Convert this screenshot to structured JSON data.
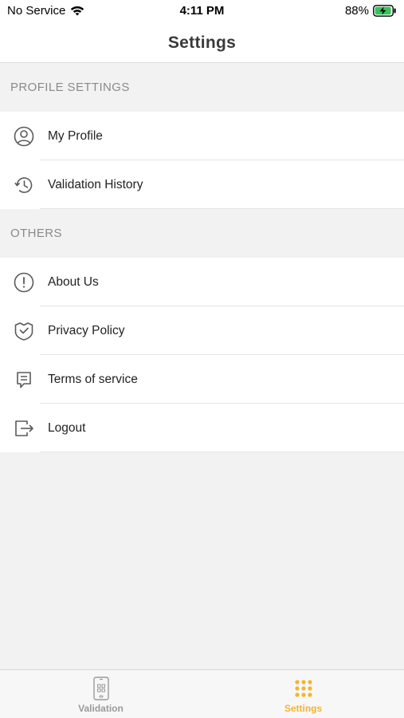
{
  "status_bar": {
    "carrier": "No Service",
    "time": "4:11 PM",
    "battery": "88%"
  },
  "header": {
    "title": "Settings"
  },
  "sections": [
    {
      "title": "PROFILE SETTINGS",
      "items": [
        {
          "label": "My Profile",
          "icon": "user-circle-icon"
        },
        {
          "label": "Validation History",
          "icon": "history-icon"
        }
      ]
    },
    {
      "title": "OTHERS",
      "items": [
        {
          "label": "About Us",
          "icon": "info-circle-icon"
        },
        {
          "label": "Privacy Policy",
          "icon": "shield-check-icon"
        },
        {
          "label": "Terms of service",
          "icon": "document-icon"
        },
        {
          "label": "Logout",
          "icon": "logout-icon"
        }
      ]
    }
  ],
  "tab_bar": {
    "tabs": [
      {
        "label": "Validation",
        "icon": "phone-qr-icon",
        "active": false
      },
      {
        "label": "Settings",
        "icon": "grid-dots-icon",
        "active": true
      }
    ]
  },
  "colors": {
    "accent": "#f5b52e",
    "inactive_tab": "#9a9a9a",
    "icon_stroke": "#5a5a5a",
    "section_text": "#8a8a8a"
  }
}
